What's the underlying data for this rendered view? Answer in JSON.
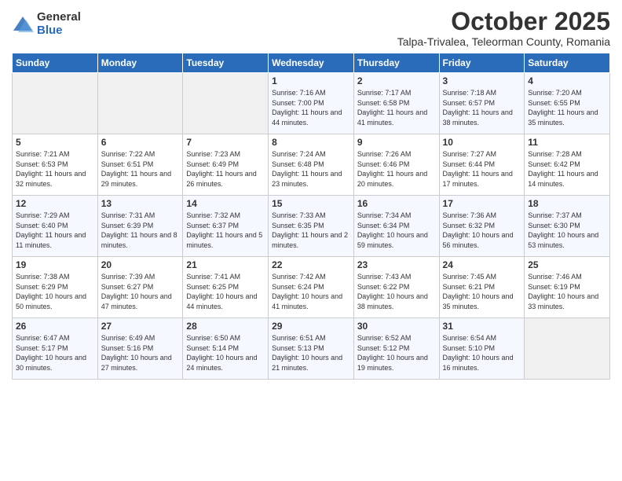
{
  "logo": {
    "general": "General",
    "blue": "Blue"
  },
  "title": "October 2025",
  "subtitle": "Talpa-Trivalea, Teleorman County, Romania",
  "weekdays": [
    "Sunday",
    "Monday",
    "Tuesday",
    "Wednesday",
    "Thursday",
    "Friday",
    "Saturday"
  ],
  "weeks": [
    [
      {
        "day": "",
        "info": ""
      },
      {
        "day": "",
        "info": ""
      },
      {
        "day": "",
        "info": ""
      },
      {
        "day": "1",
        "info": "Sunrise: 7:16 AM\nSunset: 7:00 PM\nDaylight: 11 hours and 44 minutes."
      },
      {
        "day": "2",
        "info": "Sunrise: 7:17 AM\nSunset: 6:58 PM\nDaylight: 11 hours and 41 minutes."
      },
      {
        "day": "3",
        "info": "Sunrise: 7:18 AM\nSunset: 6:57 PM\nDaylight: 11 hours and 38 minutes."
      },
      {
        "day": "4",
        "info": "Sunrise: 7:20 AM\nSunset: 6:55 PM\nDaylight: 11 hours and 35 minutes."
      }
    ],
    [
      {
        "day": "5",
        "info": "Sunrise: 7:21 AM\nSunset: 6:53 PM\nDaylight: 11 hours and 32 minutes."
      },
      {
        "day": "6",
        "info": "Sunrise: 7:22 AM\nSunset: 6:51 PM\nDaylight: 11 hours and 29 minutes."
      },
      {
        "day": "7",
        "info": "Sunrise: 7:23 AM\nSunset: 6:49 PM\nDaylight: 11 hours and 26 minutes."
      },
      {
        "day": "8",
        "info": "Sunrise: 7:24 AM\nSunset: 6:48 PM\nDaylight: 11 hours and 23 minutes."
      },
      {
        "day": "9",
        "info": "Sunrise: 7:26 AM\nSunset: 6:46 PM\nDaylight: 11 hours and 20 minutes."
      },
      {
        "day": "10",
        "info": "Sunrise: 7:27 AM\nSunset: 6:44 PM\nDaylight: 11 hours and 17 minutes."
      },
      {
        "day": "11",
        "info": "Sunrise: 7:28 AM\nSunset: 6:42 PM\nDaylight: 11 hours and 14 minutes."
      }
    ],
    [
      {
        "day": "12",
        "info": "Sunrise: 7:29 AM\nSunset: 6:40 PM\nDaylight: 11 hours and 11 minutes."
      },
      {
        "day": "13",
        "info": "Sunrise: 7:31 AM\nSunset: 6:39 PM\nDaylight: 11 hours and 8 minutes."
      },
      {
        "day": "14",
        "info": "Sunrise: 7:32 AM\nSunset: 6:37 PM\nDaylight: 11 hours and 5 minutes."
      },
      {
        "day": "15",
        "info": "Sunrise: 7:33 AM\nSunset: 6:35 PM\nDaylight: 11 hours and 2 minutes."
      },
      {
        "day": "16",
        "info": "Sunrise: 7:34 AM\nSunset: 6:34 PM\nDaylight: 10 hours and 59 minutes."
      },
      {
        "day": "17",
        "info": "Sunrise: 7:36 AM\nSunset: 6:32 PM\nDaylight: 10 hours and 56 minutes."
      },
      {
        "day": "18",
        "info": "Sunrise: 7:37 AM\nSunset: 6:30 PM\nDaylight: 10 hours and 53 minutes."
      }
    ],
    [
      {
        "day": "19",
        "info": "Sunrise: 7:38 AM\nSunset: 6:29 PM\nDaylight: 10 hours and 50 minutes."
      },
      {
        "day": "20",
        "info": "Sunrise: 7:39 AM\nSunset: 6:27 PM\nDaylight: 10 hours and 47 minutes."
      },
      {
        "day": "21",
        "info": "Sunrise: 7:41 AM\nSunset: 6:25 PM\nDaylight: 10 hours and 44 minutes."
      },
      {
        "day": "22",
        "info": "Sunrise: 7:42 AM\nSunset: 6:24 PM\nDaylight: 10 hours and 41 minutes."
      },
      {
        "day": "23",
        "info": "Sunrise: 7:43 AM\nSunset: 6:22 PM\nDaylight: 10 hours and 38 minutes."
      },
      {
        "day": "24",
        "info": "Sunrise: 7:45 AM\nSunset: 6:21 PM\nDaylight: 10 hours and 35 minutes."
      },
      {
        "day": "25",
        "info": "Sunrise: 7:46 AM\nSunset: 6:19 PM\nDaylight: 10 hours and 33 minutes."
      }
    ],
    [
      {
        "day": "26",
        "info": "Sunrise: 6:47 AM\nSunset: 5:17 PM\nDaylight: 10 hours and 30 minutes."
      },
      {
        "day": "27",
        "info": "Sunrise: 6:49 AM\nSunset: 5:16 PM\nDaylight: 10 hours and 27 minutes."
      },
      {
        "day": "28",
        "info": "Sunrise: 6:50 AM\nSunset: 5:14 PM\nDaylight: 10 hours and 24 minutes."
      },
      {
        "day": "29",
        "info": "Sunrise: 6:51 AM\nSunset: 5:13 PM\nDaylight: 10 hours and 21 minutes."
      },
      {
        "day": "30",
        "info": "Sunrise: 6:52 AM\nSunset: 5:12 PM\nDaylight: 10 hours and 19 minutes."
      },
      {
        "day": "31",
        "info": "Sunrise: 6:54 AM\nSunset: 5:10 PM\nDaylight: 10 hours and 16 minutes."
      },
      {
        "day": "",
        "info": ""
      }
    ]
  ]
}
